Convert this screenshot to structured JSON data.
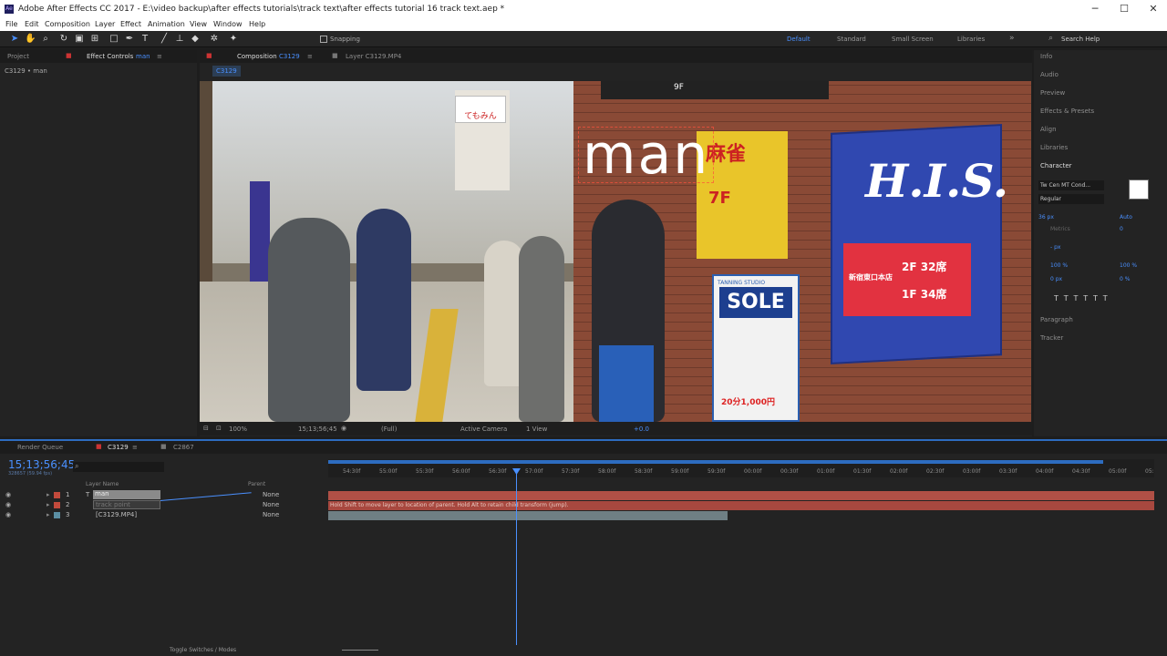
{
  "app": {
    "title": "Adobe After Effects CC 2017 - E:\\video backup\\after effects tutorials\\track text\\after effects tutorial 16 track text.aep *",
    "logo": "Ae"
  },
  "menu": [
    "File",
    "Edit",
    "Composition",
    "Layer",
    "Effect",
    "Animation",
    "View",
    "Window",
    "Help"
  ],
  "toolbar": {
    "snapping": "Snapping",
    "workspaces": [
      "Default",
      "Standard",
      "Small Screen",
      "Libraries"
    ],
    "search_placeholder": "Search Help"
  },
  "left_panel": {
    "tab_project": "Project",
    "tab_effect_controls": "Effect Controls",
    "effect_target": "man",
    "breadcrumb": "C3129 • man"
  },
  "viewer": {
    "tab_composition": "Composition",
    "comp_name": "C3129",
    "tab_layer": "Layer C3129.MP4",
    "comp_chip": "C3129",
    "overlay_text": "man",
    "controls": {
      "zoom": "100%",
      "timecode": "15;13;56;45",
      "resolution": "(Full)",
      "camera": "Active Camera",
      "views": "1 View",
      "exposure": "+0.0"
    }
  },
  "right_panel": {
    "items": [
      "Info",
      "Audio",
      "Preview",
      "Effects & Presets",
      "Align",
      "Libraries",
      "Character"
    ],
    "bottom_items": [
      "Paragraph",
      "Tracker"
    ],
    "character": {
      "font": "Tw Cen MT Cond...",
      "style": "Regular",
      "size": "36 px",
      "leading": "Auto",
      "kerning": "Metrics",
      "tracking": "0",
      "stroke_width": "- px",
      "vscale": "100 %",
      "hscale": "100 %",
      "baseline": "0 px",
      "tsume": "0 %",
      "fill_color": "#ffffff"
    }
  },
  "timeline": {
    "tabs": [
      "Render Queue",
      "C3129",
      "C2867"
    ],
    "current_time": "15;13;56;45",
    "frame_info": "328657 (59.94 fps)",
    "col_layer_name": "Layer Name",
    "col_parent": "Parent",
    "layers": [
      {
        "num": "1",
        "type": "T",
        "name": "man",
        "parent": "None",
        "color": "#c24a3c"
      },
      {
        "num": "2",
        "type": "",
        "name": "track point",
        "parent": "None",
        "color": "#c24a3c"
      },
      {
        "num": "3",
        "type": "",
        "name": "[C3129.MP4]",
        "parent": "None",
        "color": "#5b8fa3"
      }
    ],
    "hint": "Hold Shift to move layer to location of parent. Hold Alt to retain child transform (jump).",
    "ruler": [
      "54:30f",
      "55:00f",
      "55:30f",
      "56:00f",
      "56:30f",
      "57:00f",
      "57:30f",
      "58:00f",
      "58:30f",
      "59:00f",
      "59:30f",
      "00:00f",
      "00:30f",
      "01:00f",
      "01:30f",
      "02:00f",
      "02:30f",
      "03:00f",
      "03:30f",
      "04:00f",
      "04:30f",
      "05:00f",
      "05:"
    ],
    "toggle_label": "Toggle Switches / Modes"
  },
  "scene": {
    "sign_brand": "H.I.S.",
    "sign_sub": "新宿東口本店",
    "sign_floors": [
      "2F 32席",
      "1F 34席"
    ],
    "shop_sign": "SOLE",
    "shop_sub": "TANNING STUDIO",
    "sign_top": "てもみん",
    "sign_kanji": "麻雀",
    "price": "20分1,000円",
    "floor_7f": "7F",
    "floor_9f": "9F"
  }
}
